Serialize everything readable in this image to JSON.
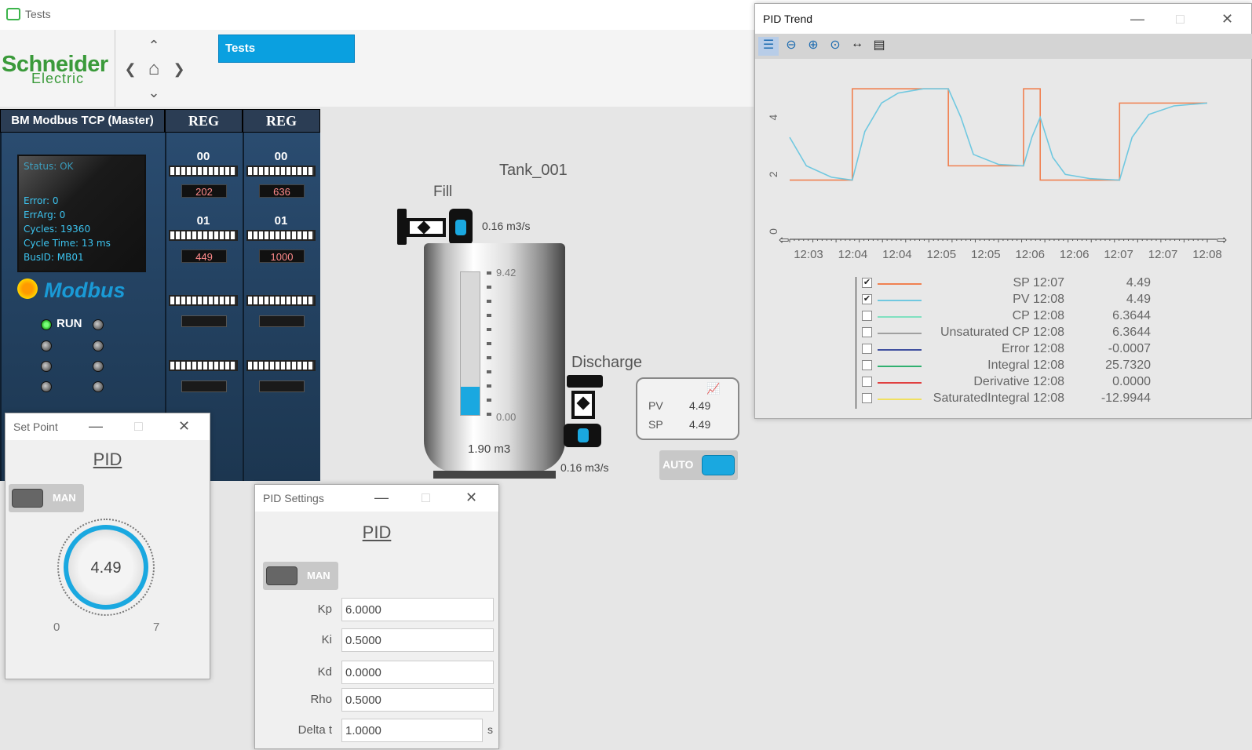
{
  "app": {
    "title": "Tests"
  },
  "header": {
    "logo_line1": "Schneider",
    "logo_line2": "Electric",
    "tab": "Tests"
  },
  "plc": {
    "headers": [
      "BM Modbus TCP (Master)",
      "REG",
      "REG"
    ],
    "status": [
      "Status: OK",
      "Error: 0",
      "ErrArg: 0",
      "Cycles: 19360",
      "Cycle Time: 13 ms",
      "BusID: MB01"
    ],
    "modbus_logo": "Modbus",
    "run_label": "RUN",
    "reg1": {
      "idx0": "00",
      "val0": "202",
      "idx1": "01",
      "val1": "449"
    },
    "reg2": {
      "idx0": "00",
      "val0": "636",
      "idx1": "01",
      "val1": "1000"
    }
  },
  "process": {
    "tank_name": "Tank_001",
    "fill_label": "Fill",
    "fill_flow": "0.16 m3/s",
    "gauge_max": "9.42",
    "gauge_min": "0.00",
    "gauge_level": 0.2,
    "tank_volume": "1.90 m3",
    "discharge_label": "Discharge",
    "discharge_flow": "0.16 m3/s",
    "pv_label": "PV",
    "pv_value": "4.49",
    "sp_label": "SP",
    "sp_value": "4.49",
    "auto_label": "AUTO"
  },
  "setpoint_win": {
    "title": "Set Point",
    "pid_link": "PID",
    "toggle_label": "MAN",
    "knob_value": "4.49",
    "knob_min": "0",
    "knob_max": "7"
  },
  "settings_win": {
    "title": "PID Settings",
    "pid_link": "PID",
    "toggle_label": "MAN",
    "fields": [
      {
        "label": "Kp",
        "value": "6.0000"
      },
      {
        "label": "Ki",
        "value": "0.5000"
      },
      {
        "label": "Kd",
        "value": "0.0000"
      },
      {
        "label": "Rho",
        "value": "0.5000"
      },
      {
        "label": "Delta t",
        "value": "1.0000"
      }
    ],
    "unit_s": "s"
  },
  "trend_win": {
    "title": "PID Trend",
    "toolbar_icons": [
      "legend-icon",
      "zoom-out-icon",
      "zoom-in-icon",
      "zoom-reset-icon",
      "pan-icon",
      "history-icon"
    ],
    "legend": [
      {
        "checked": true,
        "color": "#f08050",
        "name": "SP 12:07",
        "value": "4.49"
      },
      {
        "checked": true,
        "color": "#70c8e0",
        "name": "PV 12:08",
        "value": "4.49"
      },
      {
        "checked": false,
        "color": "#80e0c0",
        "name": "CP 12:08",
        "value": "6.3644"
      },
      {
        "checked": false,
        "color": "#a0a0a0",
        "name": "Unsaturated CP 12:08",
        "value": "6.3644"
      },
      {
        "checked": false,
        "color": "#4050a0",
        "name": "Error 12:08",
        "value": "-0.0007"
      },
      {
        "checked": false,
        "color": "#30b070",
        "name": "Integral 12:08",
        "value": "25.7320"
      },
      {
        "checked": false,
        "color": "#e04040",
        "name": "Derivative 12:08",
        "value": "0.0000"
      },
      {
        "checked": false,
        "color": "#f0e060",
        "name": "SaturatedIntegral 12:08",
        "value": "-12.9944"
      }
    ]
  },
  "chart_data": {
    "type": "line",
    "x_ticks": [
      "12:03",
      "12:04",
      "12:04",
      "12:05",
      "12:05",
      "12:06",
      "12:06",
      "12:07",
      "12:07",
      "12:08"
    ],
    "y_ticks": [
      "0",
      "2",
      "4"
    ],
    "ylim": [
      0,
      5.5
    ],
    "xlim": [
      0,
      100
    ],
    "series": [
      {
        "name": "SP",
        "color": "#f08050",
        "x": [
          0,
          15,
          15,
          38,
          38,
          56,
          56,
          60,
          60,
          79,
          79,
          100
        ],
        "y": [
          1.8,
          1.8,
          5.0,
          5.0,
          2.3,
          2.3,
          5.0,
          5.0,
          1.8,
          1.8,
          4.5,
          4.5
        ]
      },
      {
        "name": "PV",
        "color": "#70c8e0",
        "x": [
          0,
          4,
          10,
          15,
          18,
          22,
          26,
          32,
          38,
          41,
          44,
          50,
          56,
          58,
          60,
          63,
          66,
          72,
          79,
          82,
          86,
          92,
          100
        ],
        "y": [
          3.3,
          2.3,
          1.9,
          1.8,
          3.5,
          4.5,
          4.85,
          5.0,
          5.0,
          4.0,
          2.7,
          2.35,
          2.3,
          3.3,
          4.0,
          2.6,
          2.0,
          1.85,
          1.8,
          3.3,
          4.1,
          4.4,
          4.5
        ]
      }
    ]
  }
}
